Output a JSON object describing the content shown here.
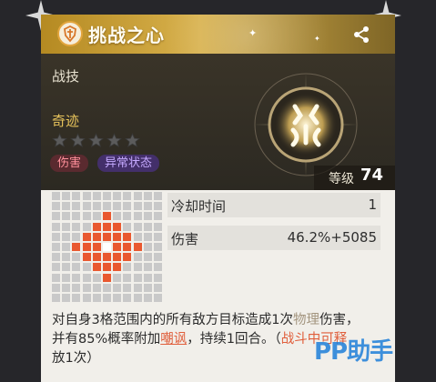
{
  "header": {
    "title": "挑战之心"
  },
  "skill": {
    "category": "战技",
    "tier_name": "奇迹",
    "stars_filled": 0,
    "stars_total": 5,
    "tags": [
      "伤害",
      "异常状态"
    ],
    "level_label": "等级",
    "level_value": "74"
  },
  "stats": [
    {
      "label": "冷却时间",
      "value": "1"
    },
    {
      "label": "伤害",
      "value": "46.2%+5085"
    }
  ],
  "range_grid": {
    "size": 11,
    "center": [
      5,
      5
    ],
    "area_radius": 3,
    "colors": {
      "background": "#c9c9c9",
      "area": "#e9582f",
      "center": "#ffffff"
    }
  },
  "description": {
    "line1_a": "对自身3格范围内的所有敌方目标造成1次",
    "line1_kw": "物理",
    "line1_b": "伤害，",
    "line2_a": "并有85%概率附加",
    "line2_kw": "嘲讽",
    "line2_b": "，持续1回合。（",
    "line2_c": "战斗中可释",
    "line3": "放1次）"
  },
  "watermark": "PP助手",
  "colors": {
    "title_gold": "#d8b14c",
    "accent_orange": "#e9582f",
    "tier_gold": "#e9c55c"
  }
}
